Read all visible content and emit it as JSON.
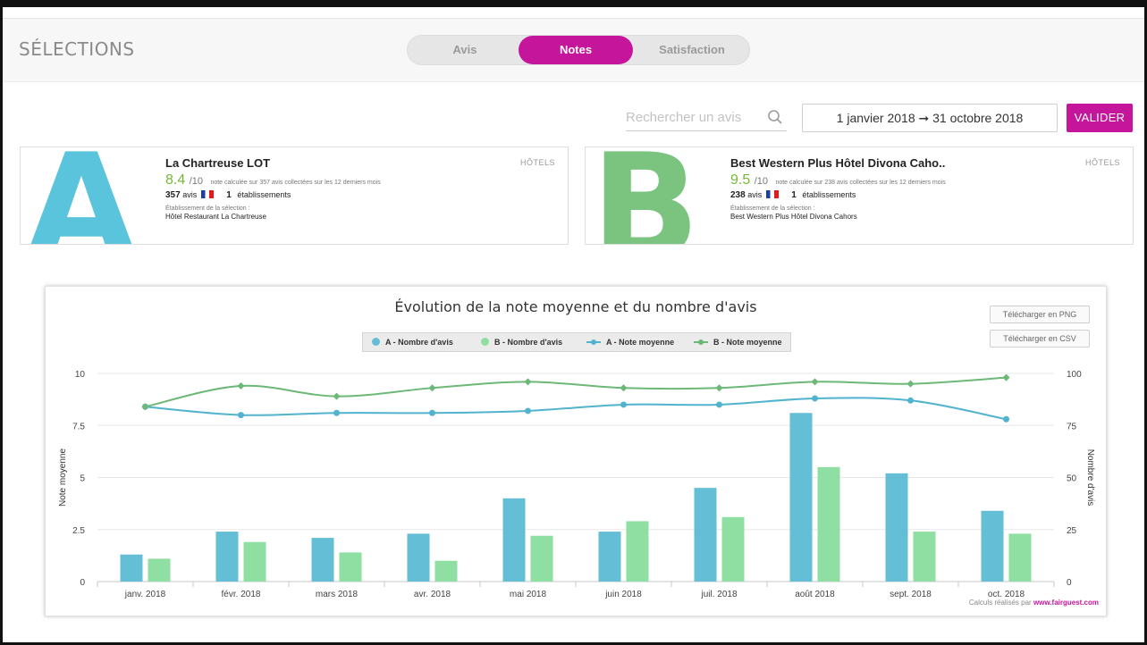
{
  "header": {
    "title": "SÉLECTIONS",
    "tabs": [
      {
        "label": "Avis",
        "active": false
      },
      {
        "label": "Notes",
        "active": true
      },
      {
        "label": "Satisfaction",
        "active": false
      }
    ]
  },
  "search": {
    "placeholder": "Rechercher un avis",
    "icon": "search-icon"
  },
  "daterange": {
    "text": "1 janvier 2018 ➞ 31 octobre 2018"
  },
  "validate_label": "VALIDER",
  "cards": [
    {
      "letter": "A",
      "letter_color": "#5bc4dd",
      "name": "La Chartreuse LOT",
      "category": "HÔTELS",
      "score": "8.4",
      "score_color": "#74b934",
      "denominator": "/10",
      "score_note": "note calculée sur 357 avis collectées sur les 12 derniers mois",
      "reviews": "357",
      "reviews_label": "avis",
      "establishments": "1",
      "establishments_label": "établissements",
      "selection_label": "Établissement de la sélection :",
      "selection": "Hôtel Restaurant La Chartreuse"
    },
    {
      "letter": "B",
      "letter_color": "#7bc47f",
      "name": "Best Western Plus Hôtel Divona Caho..",
      "category": "HÔTELS",
      "score": "9.5",
      "score_color": "#74b934",
      "denominator": "/10",
      "score_note": "note calculée sur 238 avis collectées sur les 12 derniers mois",
      "reviews": "238",
      "reviews_label": "avis",
      "establishments": "1",
      "establishments_label": "établissements",
      "selection_label": "Établissement de la sélection :",
      "selection": "Best Western Plus Hôtel Divona Cahors"
    }
  ],
  "chart": {
    "download_png": "Télécharger en PNG",
    "download_csv": "Télécharger en CSV",
    "credit_prefix": "Calculs réalisés par",
    "credit_link": "www.fairguest.com"
  },
  "chart_data": {
    "type": "bar",
    "title": "Évolution de la note moyenne et du nombre d'avis",
    "categories": [
      "janv. 2018",
      "févr. 2018",
      "mars 2018",
      "avr. 2018",
      "mai 2018",
      "juin 2018",
      "juil. 2018",
      "août 2018",
      "sept. 2018",
      "oct. 2018"
    ],
    "ylabel_left": "Note moyenne",
    "ylabel_right": "Nombre d'avis",
    "ylim_left": [
      0,
      10
    ],
    "yticks_left": [
      "0",
      "2.5",
      "5",
      "7.5",
      "10"
    ],
    "ylim_right": [
      0,
      100
    ],
    "yticks_right": [
      "0",
      "25",
      "50",
      "75",
      "100"
    ],
    "grid": true,
    "legend_position": "top-center",
    "series": [
      {
        "name": "A - Nombre d'avis",
        "kind": "bar",
        "axis": "right",
        "color": "#64bed6",
        "values": [
          13,
          24,
          21,
          23,
          40,
          24,
          45,
          81,
          52,
          34
        ]
      },
      {
        "name": "B - Nombre d'avis",
        "kind": "bar",
        "axis": "right",
        "color": "#8fdfa3",
        "values": [
          11,
          19,
          14,
          10,
          22,
          29,
          31,
          55,
          24,
          23
        ]
      },
      {
        "name": "A - Note moyenne",
        "kind": "line",
        "axis": "left",
        "color": "#52b3cf",
        "values": [
          8.4,
          8.0,
          8.1,
          8.1,
          8.2,
          8.5,
          8.5,
          8.8,
          8.7,
          7.8
        ]
      },
      {
        "name": "B - Note moyenne",
        "kind": "line",
        "axis": "left",
        "color": "#6cb877",
        "values": [
          8.4,
          9.4,
          8.9,
          9.3,
          9.6,
          9.3,
          9.3,
          9.6,
          9.5,
          9.8
        ]
      }
    ]
  }
}
